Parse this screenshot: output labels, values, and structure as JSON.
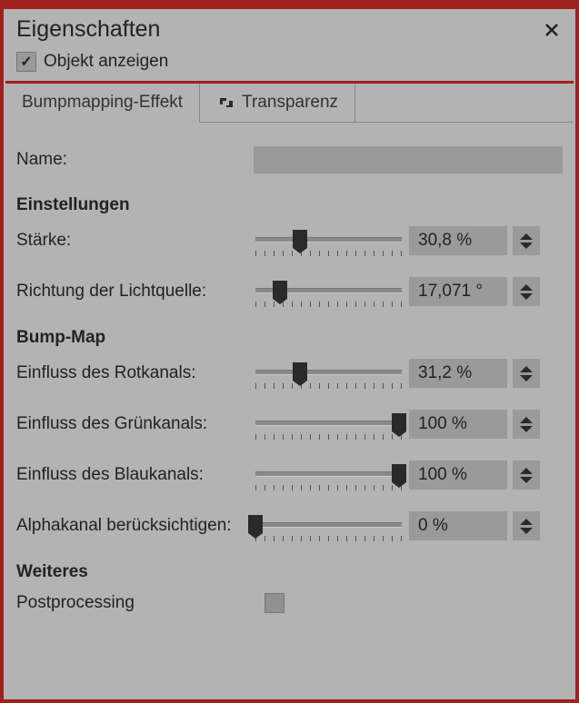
{
  "header": {
    "title": "Eigenschaften"
  },
  "show": {
    "checked": true,
    "label": "Objekt anzeigen"
  },
  "tabs": [
    {
      "label": "Bumpmapping-Effekt",
      "active": true
    },
    {
      "label": "Transparenz",
      "active": false
    }
  ],
  "name_row": {
    "label": "Name:",
    "value": ""
  },
  "sections": {
    "settings": "Einstellungen",
    "bumpmap": "Bump-Map",
    "more": "Weiteres"
  },
  "sliders": {
    "strength": {
      "label": "Stärke:",
      "value": "30,8 %",
      "pos": 30.8
    },
    "lightdir": {
      "label": "Richtung der Lichtquelle:",
      "value": "17,071 °",
      "pos": 17.1
    },
    "red": {
      "label": "Einfluss des Rotkanals:",
      "value": "31,2 %",
      "pos": 31.2
    },
    "green": {
      "label": "Einfluss des Grünkanals:",
      "value": "100 %",
      "pos": 100
    },
    "blue": {
      "label": "Einfluss des Blaukanals:",
      "value": "100 %",
      "pos": 100
    },
    "alpha": {
      "label": "Alphakanal berücksichtigen:",
      "value": "0 %",
      "pos": 0
    }
  },
  "postprocessing": {
    "label": "Postprocessing",
    "checked": false
  }
}
